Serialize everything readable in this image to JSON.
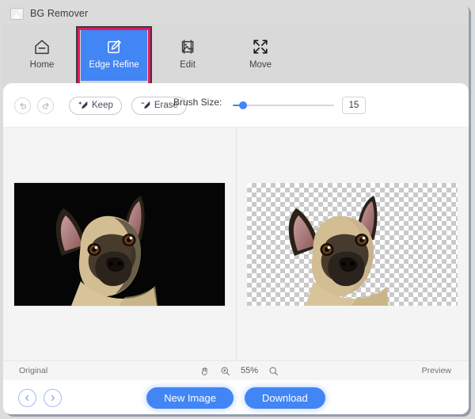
{
  "window": {
    "title": "BG Remover",
    "app_icon": "image-icon"
  },
  "ribbon": {
    "tools": [
      {
        "id": "home",
        "label": "Home",
        "icon": "home-icon",
        "active": false
      },
      {
        "id": "edge-refine",
        "label": "Edge Refine",
        "icon": "edge-refine-icon",
        "active": true
      },
      {
        "id": "edit",
        "label": "Edit",
        "icon": "edit-image-icon",
        "active": false
      },
      {
        "id": "move",
        "label": "Move",
        "icon": "move-icon",
        "active": false
      }
    ],
    "active_color": "#4285f4",
    "highlight_color": "#e8175d"
  },
  "options": {
    "undo_icon": "undo-arrow-icon",
    "redo_icon": "redo-arrow-icon",
    "keep_label": "Keep",
    "keep_icon": "brush-keep-icon",
    "erase_label": "Erase",
    "erase_icon": "brush-erase-icon",
    "brush_size_label": "Brush Size:",
    "brush_size_value": "15",
    "slider_percent": 9
  },
  "canvas": {
    "left_pane": {
      "label": "Original",
      "background": "black",
      "subject": "french-bulldog-photo"
    },
    "right_pane": {
      "label": "Preview",
      "background": "transparent-checkerboard",
      "subject": "french-bulldog-cutout"
    }
  },
  "status": {
    "left_label": "Original",
    "right_label": "Preview",
    "hand_icon": "hand-tool-icon",
    "zoom_in_icon": "zoom-in-icon",
    "zoom_out_icon": "zoom-out-icon",
    "zoom_value": "55%"
  },
  "actions": {
    "prev_icon": "chevron-left-icon",
    "next_icon": "chevron-right-icon",
    "new_image_label": "New Image",
    "download_label": "Download",
    "button_color": "#4285f4"
  }
}
